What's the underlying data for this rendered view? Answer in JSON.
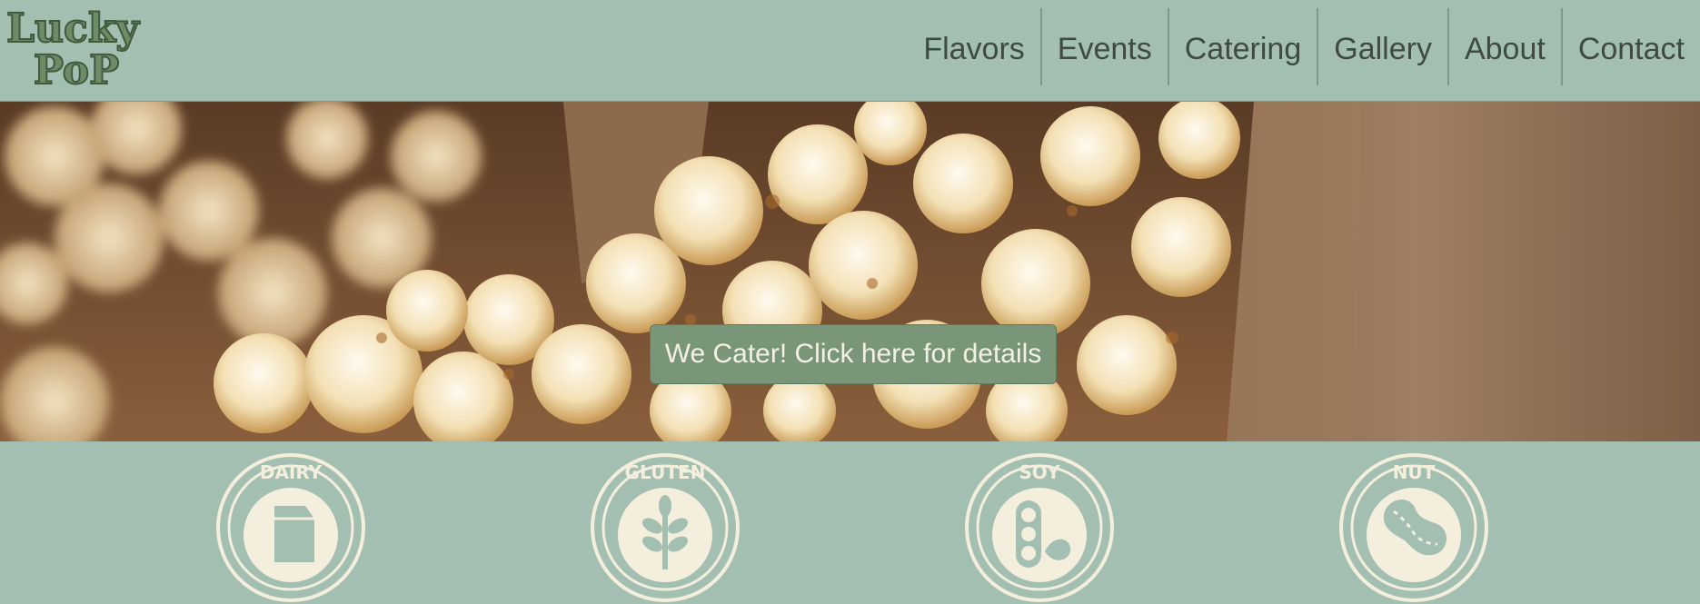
{
  "brand": {
    "logo_line1": "Lucky",
    "logo_line2": "PoP",
    "primary_color": "#a3bfb2",
    "accent_color": "#7a9679",
    "logo_color": "#6f8a66",
    "cream": "#f4efdc"
  },
  "nav": {
    "items": [
      {
        "label": "Flavors"
      },
      {
        "label": "Events"
      },
      {
        "label": "Catering"
      },
      {
        "label": "Gallery"
      },
      {
        "label": "About"
      },
      {
        "label": "Contact"
      }
    ]
  },
  "hero": {
    "cta_label": "We Cater! Click here for details"
  },
  "allergens": [
    {
      "label": "DAIRY",
      "icon": "milk-carton-icon"
    },
    {
      "label": "GLUTEN",
      "icon": "wheat-icon"
    },
    {
      "label": "SOY",
      "icon": "soybean-icon"
    },
    {
      "label": "NUT",
      "icon": "peanut-icon"
    }
  ]
}
